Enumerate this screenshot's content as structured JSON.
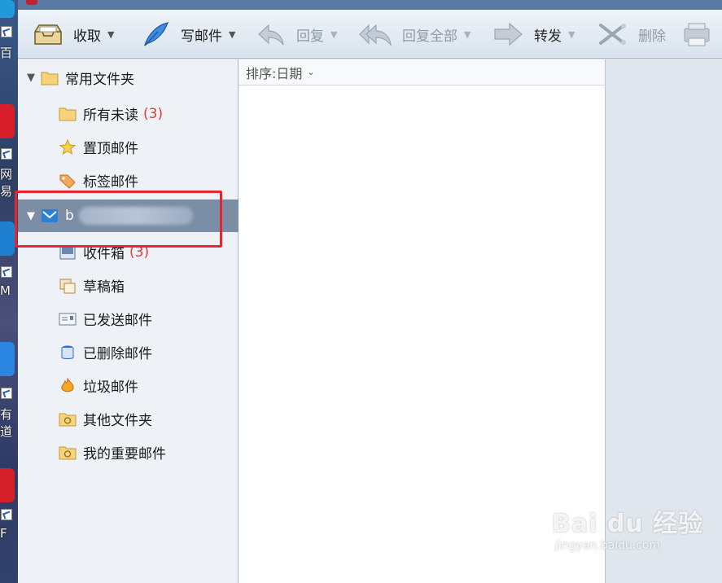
{
  "toolbar": {
    "receive": "收取",
    "compose": "写邮件",
    "reply": "回复",
    "reply_all": "回复全部",
    "forward": "转发",
    "delete": "删除"
  },
  "desktop": {
    "labels": [
      "百",
      "网易",
      "M",
      "有道",
      "F"
    ]
  },
  "tree": {
    "common_folder": "常用文件夹",
    "items_common": [
      {
        "label": "所有未读",
        "count": "(3)"
      },
      {
        "label": "置顶邮件",
        "count": ""
      },
      {
        "label": "标签邮件",
        "count": ""
      }
    ],
    "account_initial": "b",
    "items_account": [
      {
        "label": "收件箱",
        "count": "(3)"
      },
      {
        "label": "草稿箱",
        "count": ""
      },
      {
        "label": "已发送邮件",
        "count": ""
      },
      {
        "label": "已删除邮件",
        "count": ""
      },
      {
        "label": "垃圾邮件",
        "count": ""
      },
      {
        "label": "其他文件夹",
        "count": ""
      },
      {
        "label": "我的重要邮件",
        "count": ""
      }
    ]
  },
  "list": {
    "sort_label": "排序:日期"
  },
  "watermark": {
    "brand": "Bai du 经验",
    "url": "jingyan.baidu.com"
  },
  "colors": {
    "highlight": "#e8252a",
    "selected_row": "#7b8ea6",
    "count": "#e23a3a"
  }
}
